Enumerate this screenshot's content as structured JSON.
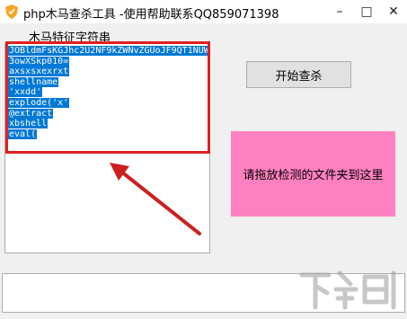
{
  "window": {
    "title": "php木马查杀工具  -使用帮助联系QQ859071398",
    "icon": "shield-icon",
    "controls": {
      "minimize": "–",
      "maximize": "□",
      "close": "✕"
    }
  },
  "signatures": {
    "label": "木马特征字符串",
    "items": [
      "JOBldmFsKGJhc2U2NF9kZWNvZGUoJF9QT1NUW",
      "3owXSkp010=",
      "axsxsxexrxt",
      "shellname",
      "'xxdd'",
      "explode('x'",
      "@extract",
      "xbshell",
      "eval("
    ]
  },
  "scan_button": {
    "label": "开始查杀"
  },
  "drop_zone": {
    "label": "请拖放检测的文件夹到这里",
    "color": "#ff80c0"
  },
  "annotation": {
    "box_color": "#e02020",
    "arrow_color": "#cc2020"
  },
  "selection_color": "#0078d7",
  "watermark": {
    "text": "下载吧"
  }
}
